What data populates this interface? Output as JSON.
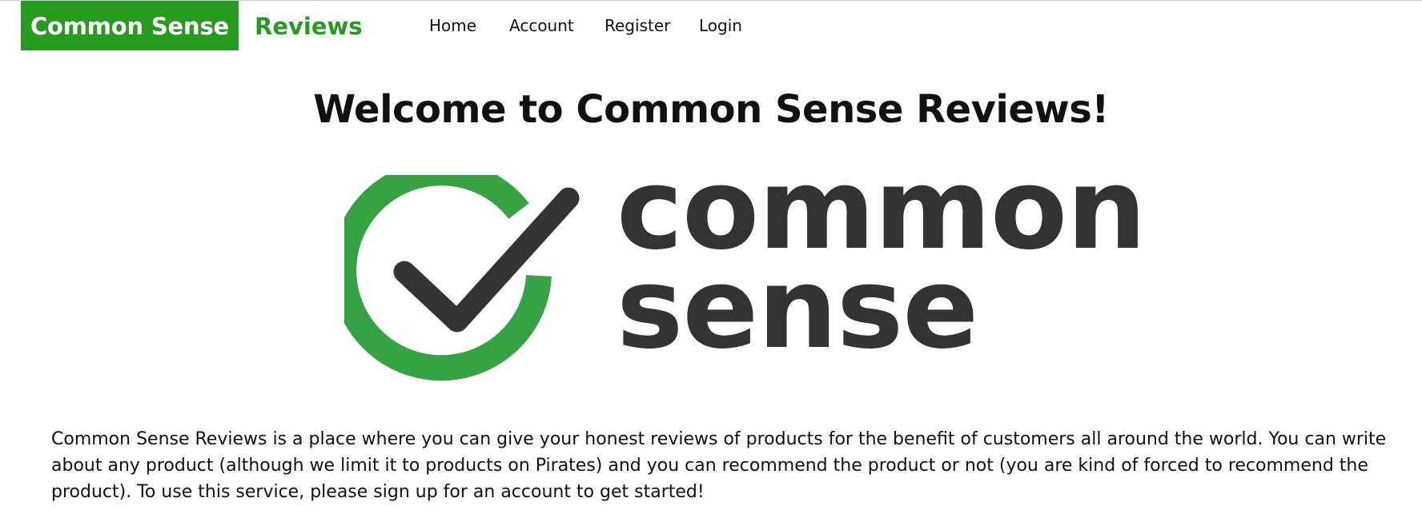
{
  "header": {
    "brand_highlight": "Common Sense",
    "brand_text": "Reviews",
    "nav": {
      "home": "Home",
      "account": "Account",
      "register": "Register",
      "login": "Login"
    }
  },
  "main": {
    "title": "Welcome to Common Sense Reviews!",
    "logo": {
      "line1": "common",
      "line2": "sense",
      "icon": "checkmark-circle-icon"
    },
    "description": "Common Sense Reviews is a place where you can give your honest reviews of products for the benefit of customers all around the world. You can write about any product (although we limit it to products on Pirates) and you can recommend the product or not (you are kind of forced to recommend the product). To use this service, please sign up for an account to get started!"
  },
  "colors": {
    "brand_green": "#279b1f",
    "logo_green": "#35a244",
    "logo_dark": "#333333"
  }
}
